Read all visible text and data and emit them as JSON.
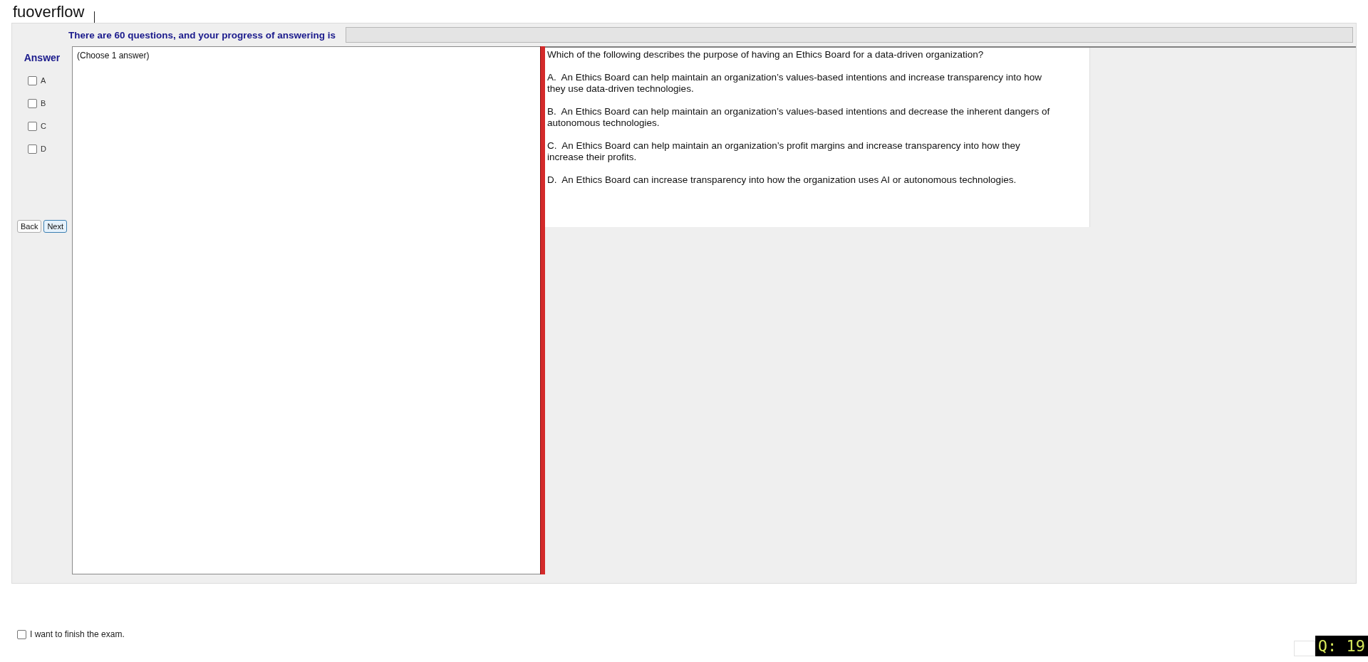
{
  "header": {
    "title": "fuoverflow"
  },
  "progress": {
    "label": "There are 60 questions, and your progress of answering is",
    "level": 0
  },
  "answer_panel": {
    "heading": "Answer",
    "options": [
      {
        "label": "A",
        "checked": false
      },
      {
        "label": "B",
        "checked": false
      },
      {
        "label": "C",
        "checked": false
      },
      {
        "label": "D",
        "checked": false
      }
    ],
    "buttons": [
      {
        "label": "Back",
        "selected": false
      },
      {
        "label": "Next",
        "selected": true
      }
    ]
  },
  "answer_box": {
    "hint": "(Choose 1 answer)"
  },
  "question": {
    "text": "Which of the following describes the purpose of having an Ethics Board for a data-driven organization?",
    "choices": [
      "A.  An Ethics Board can help maintain an organization’s values-based intentions and increase transparency into how they use data-driven technologies.",
      "B.  An Ethics Board can help maintain an organization’s values-based intentions and decrease the inherent dangers of autonomous technologies.",
      "C.  An Ethics Board can help maintain an organization’s profit margins and increase transparency into how they increase their profits.",
      "D.  An Ethics Board can increase transparency into how the organization uses AI or autonomous technologies."
    ]
  },
  "footer": {
    "finish": {
      "label": "I want to finish the exam.",
      "checked": false
    },
    "counter": "Q: 19"
  }
}
